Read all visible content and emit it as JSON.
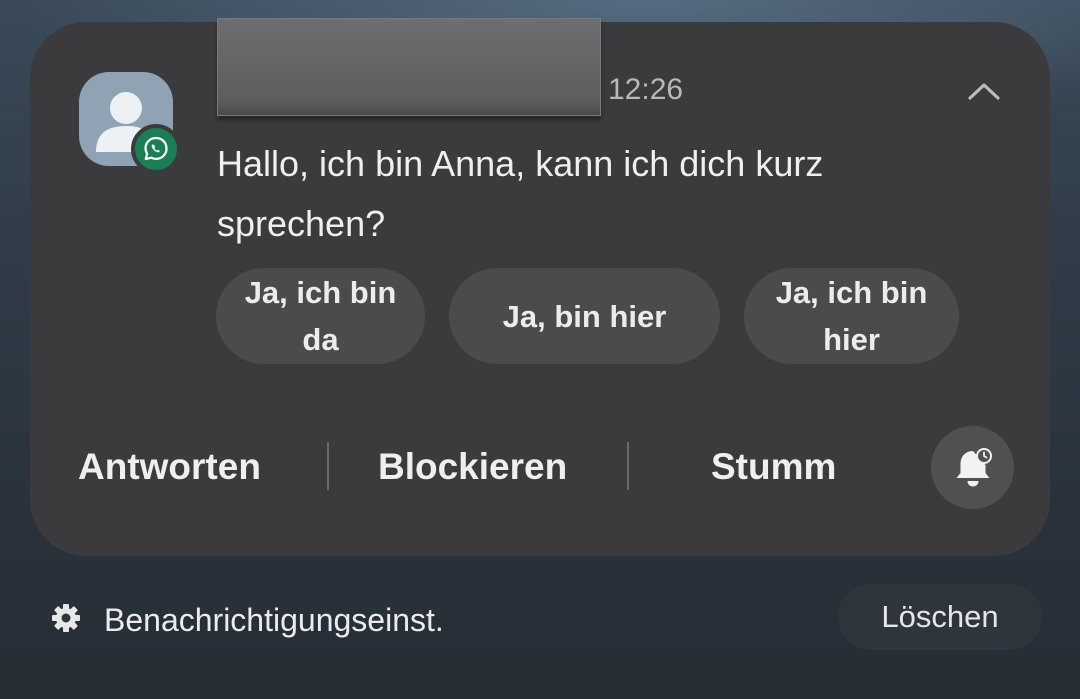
{
  "notification": {
    "app_icon": "whatsapp-icon",
    "avatar_icon": "person-icon",
    "sender_redacted": true,
    "time": "12:26",
    "collapse_icon": "chevron-up-icon",
    "message": "Hallo, ich bin Anna, kann ich dich kurz sprechen?",
    "smart_replies": [
      {
        "label": "Ja, ich bin da"
      },
      {
        "label": "Ja, bin hier"
      },
      {
        "label": "Ja, ich bin hier"
      }
    ],
    "actions": {
      "reply_label": "Antworten",
      "block_label": "Blockieren",
      "mute_label": "Stumm"
    },
    "snooze_icon": "bell-snooze-icon"
  },
  "footer": {
    "settings_icon": "gear-icon",
    "settings_label": "Benachrichtigungseinst.",
    "clear_label": "Löschen"
  },
  "colors": {
    "card": "#3b3b3d",
    "chip": "#4b4b4e",
    "whatsapp_green": "#1b7f55",
    "avatar": "#8fa3b4"
  }
}
